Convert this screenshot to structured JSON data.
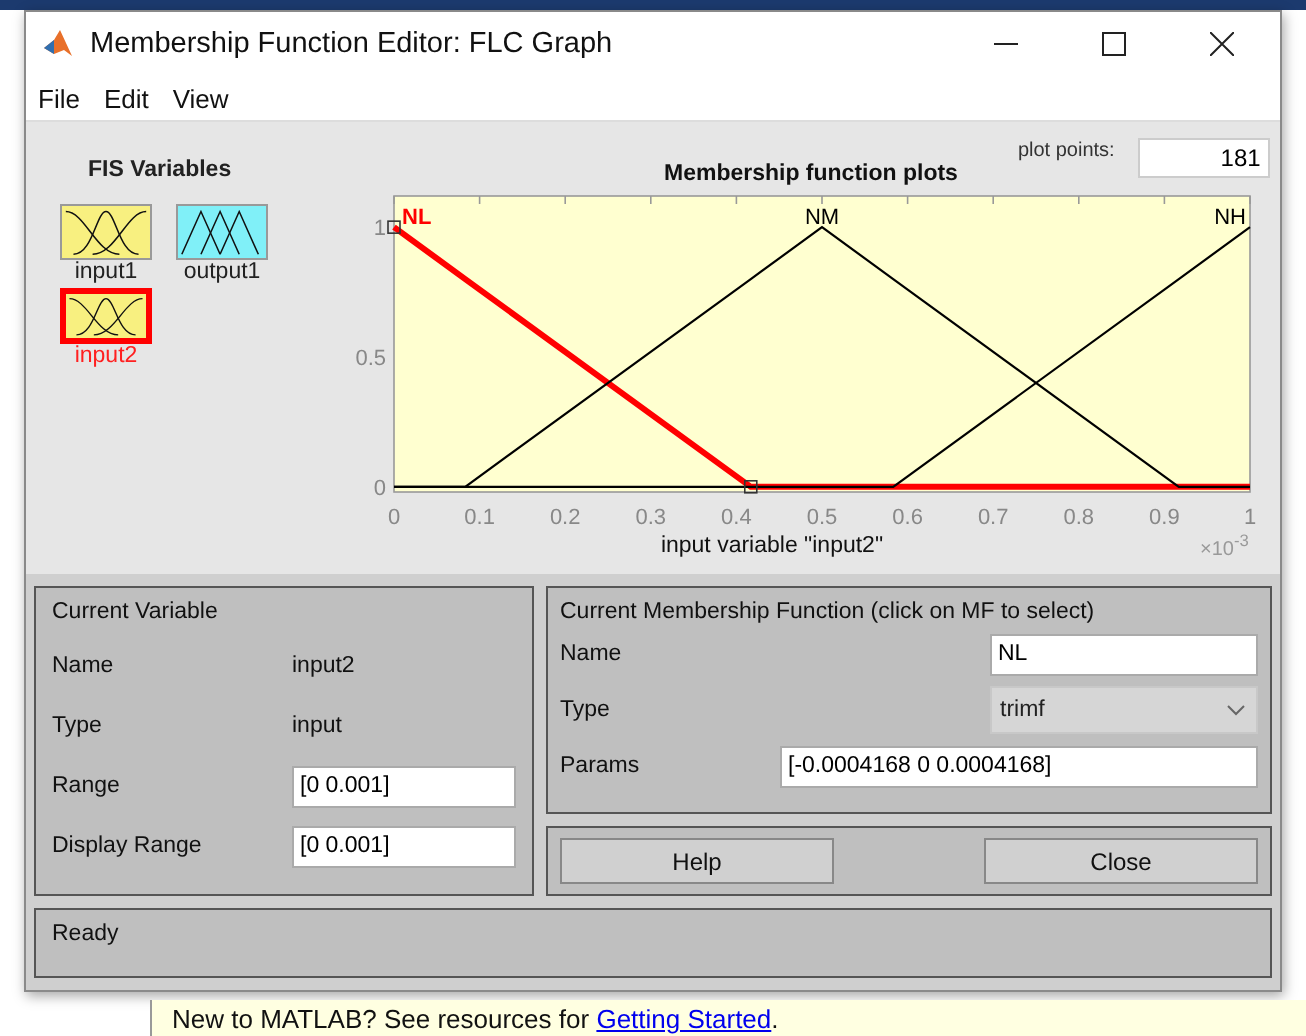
{
  "window": {
    "title": "Membership Function Editor: FLC Graph"
  },
  "menu": [
    "File",
    "Edit",
    "View"
  ],
  "fis_variables": {
    "title": "FIS Variables",
    "items": [
      {
        "label": "input1",
        "kind": "input",
        "selected": false
      },
      {
        "label": "output1",
        "kind": "output",
        "selected": false
      },
      {
        "label": "input2",
        "kind": "input",
        "selected": true
      }
    ]
  },
  "plot": {
    "mf_states": [
      {
        "selected": true
      },
      {
        "selected": false
      },
      {
        "selected": false
      }
    ],
    "plot_points_label": "plot points:",
    "plot_points": "181",
    "exponent": "×10$^{-3}$",
    "chart_data": {
      "type": "line",
      "title": "Membership function plots",
      "xlabel": "input variable \"input2\"",
      "x": [
        0,
        0.0832,
        0.4168,
        0.5,
        0.5832,
        0.9168,
        1
      ],
      "series": [
        {
          "name": "NL",
          "color": "#ff0000",
          "values": [
            1,
            0.8,
            0,
            0,
            0,
            0,
            0
          ]
        },
        {
          "name": "NM",
          "color": "#000000",
          "values": [
            0,
            0,
            0.8,
            1,
            0.8,
            0,
            0
          ]
        },
        {
          "name": "NH",
          "color": "#000000",
          "values": [
            0,
            0,
            0,
            0,
            0,
            0.8,
            1
          ]
        }
      ],
      "xlim": [
        0,
        1
      ],
      "ylim": [
        -0.02,
        1.12
      ],
      "xticks": [
        0,
        0.1,
        0.2,
        0.3,
        0.4,
        0.5,
        0.6,
        0.7,
        0.8,
        0.9,
        1
      ],
      "yticks": [
        0,
        0.5,
        1
      ]
    }
  },
  "current_variable": {
    "title": "Current Variable",
    "fields": [
      {
        "kind": "text",
        "label": "Name",
        "value": "input2"
      },
      {
        "kind": "text",
        "label": "Type",
        "value": "input"
      },
      {
        "kind": "input",
        "label": "Range",
        "value": "[0 0.001]"
      },
      {
        "kind": "input",
        "label": "Display Range",
        "value": "[0 0.001]"
      }
    ]
  },
  "current_mf": {
    "title": "Current Membership Function (click on MF to select)",
    "name_label": "Name",
    "name": "NL",
    "type_label": "Type",
    "type": "trimf",
    "params_label": "Params",
    "params": "[-0.0004168 0 0.0004168]"
  },
  "buttons": [
    "Help",
    "Close"
  ],
  "status": "Ready",
  "matlab_bar": {
    "text": "New to MATLAB? See resources for",
    "link": "Getting Started",
    "end": "."
  }
}
